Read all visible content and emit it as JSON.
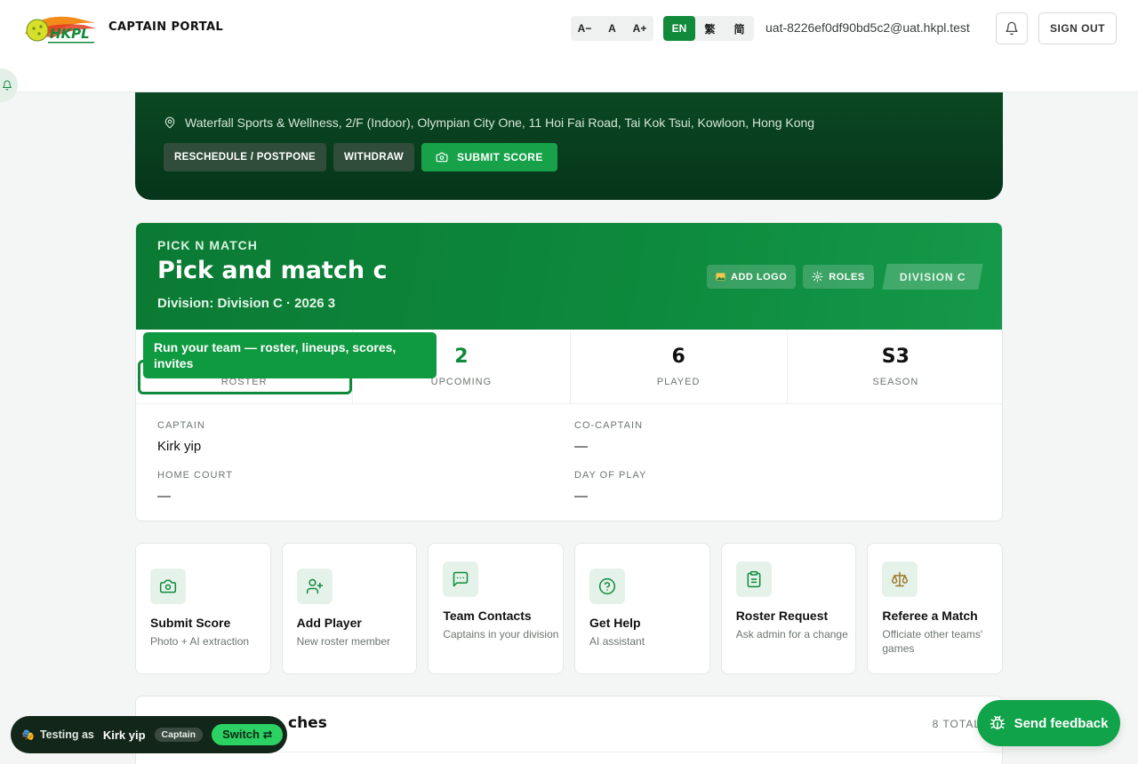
{
  "header": {
    "portal_title": "CAPTAIN PORTAL",
    "logo_text": "HKPL",
    "font_controls": [
      "A−",
      "A",
      "A+"
    ],
    "languages": [
      "EN",
      "繁",
      "简"
    ],
    "active_language": "EN",
    "email": "uat-8226ef0df90bd5c2@uat.hkpl.test",
    "sign_out": "SIGN OUT",
    "icons": [
      "bell-icon"
    ]
  },
  "match": {
    "location": "Waterfall Sports & Wellness, 2/F (Indoor), Olympian City One, 11 Hoi Fai Road, Tai Kok Tsui, Kowloon, Hong Kong",
    "actions": {
      "reschedule": "RESCHEDULE / POSTPONE",
      "withdraw": "WITHDRAW",
      "submit_score": "SUBMIT SCORE"
    }
  },
  "team": {
    "kicker": "PICK N MATCH",
    "name": "Pick and match c",
    "subtitle": "Division: Division C · 2026 3",
    "buttons": {
      "add_logo": "ADD LOGO",
      "roles": "ROLES"
    },
    "division_pill": "DIVISION C",
    "stats": [
      {
        "value": "",
        "label": "ROSTER"
      },
      {
        "value": "2",
        "label": "UPCOMING"
      },
      {
        "value": "6",
        "label": "PLAYED"
      },
      {
        "value": "S3",
        "label": "SEASON"
      }
    ],
    "tooltip": "Run your team — roster, lineups, scores, invites",
    "info": {
      "captain_label": "CAPTAIN",
      "captain_value": "Kirk yip",
      "co_captain_label": "CO-CAPTAIN",
      "co_captain_value": "—",
      "home_court_label": "HOME COURT",
      "home_court_value": "—",
      "day_of_play_label": "DAY OF PLAY",
      "day_of_play_value": "—"
    }
  },
  "quick_actions": [
    {
      "title": "Submit Score",
      "subtitle": "Photo + AI extraction",
      "icon": "camera-icon"
    },
    {
      "title": "Add Player",
      "subtitle": "New roster member",
      "icon": "add-user-icon"
    },
    {
      "title": "Team Contacts",
      "subtitle": "Captains in your division",
      "icon": "chat-icon"
    },
    {
      "title": "Get Help",
      "subtitle": "AI assistant",
      "icon": "help-icon"
    },
    {
      "title": "Roster Request",
      "subtitle": "Ask admin for a change",
      "icon": "clipboard-icon"
    },
    {
      "title": "Referee a Match",
      "subtitle": "Officiate other teams' games",
      "icon": "scales-icon"
    }
  ],
  "matches_section": {
    "title_partial": "ches",
    "total": "8 TOTAL"
  },
  "testing_bar": {
    "label": "Testing as",
    "name": "Kirk yip",
    "role": "Captain",
    "switch": "Switch ⇄"
  },
  "feedback": {
    "label": "Send feedback"
  },
  "colors": {
    "brand_green": "#0f8a3b",
    "dark_green": "#06351a",
    "accent_light": "#e5f2ea"
  }
}
